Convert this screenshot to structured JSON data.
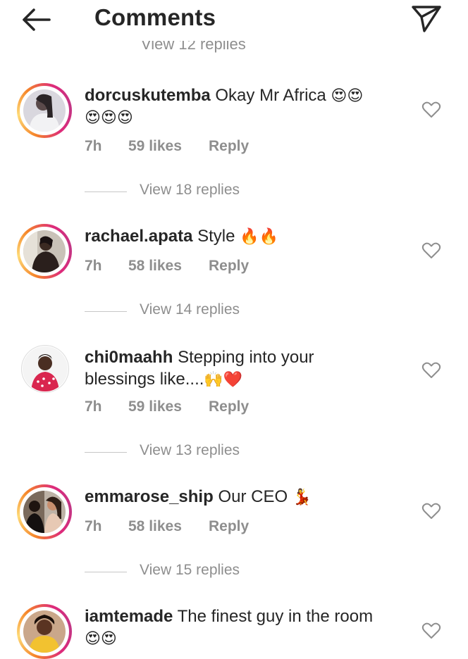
{
  "header": {
    "title": "Comments",
    "back_icon": "arrow-left-icon",
    "send_icon": "paper-plane-icon"
  },
  "top_replies": "View 12 replies",
  "comments": [
    {
      "username": "dorcuskutemba",
      "text": "Okay Mr Africa",
      "emoji_line1": "😍😍",
      "emoji_line2": "😍😍😍",
      "time": "7h",
      "likes": "59 likes",
      "reply": "Reply",
      "replies": "View 18 replies",
      "ring": "gradient"
    },
    {
      "username": "rachael.apata",
      "text": "Style",
      "emoji_line1": "🔥🔥",
      "time": "7h",
      "likes": "58 likes",
      "reply": "Reply",
      "replies": "View 14 replies",
      "ring": "gradient"
    },
    {
      "username": "chi0maahh",
      "text": "Stepping into your",
      "text_line2": "blessings like....",
      "emoji_line2": "🙌❤️",
      "time": "7h",
      "likes": "59 likes",
      "reply": "Reply",
      "replies": "View 13 replies",
      "ring": "none"
    },
    {
      "username": "emmarose_ship",
      "text": "Our CEO",
      "emoji_line1": "💃",
      "time": "7h",
      "likes": "58 likes",
      "reply": "Reply",
      "replies": "View 15 replies",
      "ring": "gradient"
    },
    {
      "username": "iamtemade",
      "text": "The finest guy in the room",
      "emoji_line2": "😍😍",
      "ring": "gradient"
    }
  ],
  "colors": {
    "text": "#262626",
    "secondary": "#8e8e8e",
    "ring_start": "#f58529",
    "ring_end": "#dd2a7b"
  }
}
